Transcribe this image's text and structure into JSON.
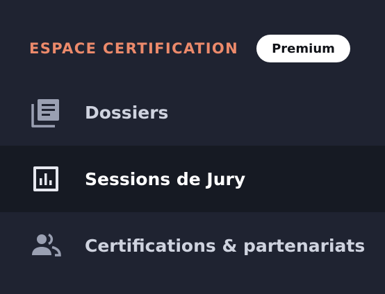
{
  "section": {
    "title": "ESPACE CERTIFICATION",
    "badge": "Premium"
  },
  "nav": {
    "items": [
      {
        "label": "Dossiers",
        "icon": "documents-stack-icon",
        "active": false
      },
      {
        "label": "Sessions de Jury",
        "icon": "bar-chart-icon",
        "active": true
      },
      {
        "label": "Certifications & partenariats",
        "icon": "people-group-icon",
        "active": false
      }
    ]
  },
  "colors": {
    "background": "#1f2331",
    "active_background": "#161a23",
    "accent": "#ec8a6b",
    "label": "#cfd3df",
    "label_active": "#ffffff",
    "icon": "#9aa0b2"
  }
}
